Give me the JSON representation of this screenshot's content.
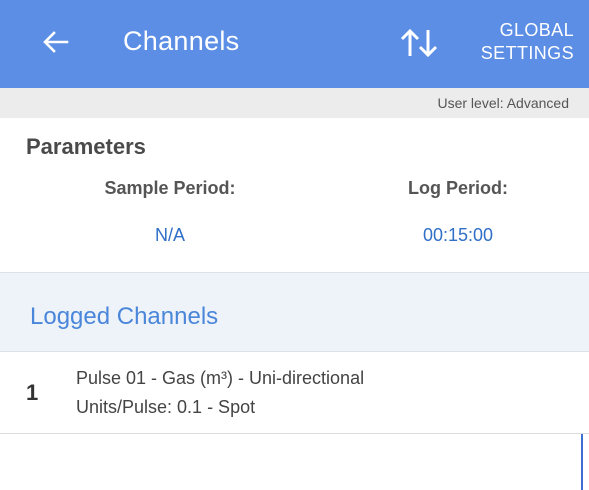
{
  "appbar": {
    "back_icon": "arrow-left-icon",
    "title": "Channels",
    "sort_icon": "sort-arrows-icon",
    "global_line1": "GLOBAL",
    "global_line2": "SETTINGS",
    "color": "#5b8ee4"
  },
  "userbar": {
    "text": "User level: Advanced"
  },
  "parameters": {
    "title": "Parameters",
    "sample_label": "Sample Period:",
    "sample_value": "N/A",
    "log_label": "Log Period:",
    "log_value": "00:15:00"
  },
  "logged": {
    "title": "Logged Channels",
    "channels": [
      {
        "number": "1",
        "line1": "Pulse 01 - Gas (m³) - Uni-directional",
        "line2": "Units/Pulse: 0.1 - Spot"
      }
    ]
  }
}
